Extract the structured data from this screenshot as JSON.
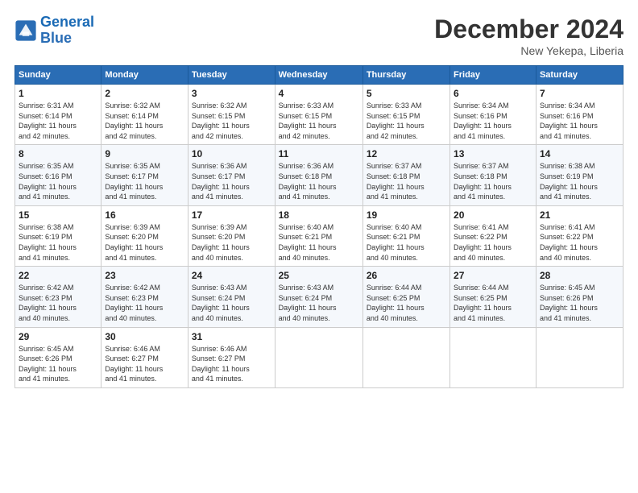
{
  "header": {
    "logo_line1": "General",
    "logo_line2": "Blue",
    "title": "December 2024",
    "subtitle": "New Yekepa, Liberia"
  },
  "days_of_week": [
    "Sunday",
    "Monday",
    "Tuesday",
    "Wednesday",
    "Thursday",
    "Friday",
    "Saturday"
  ],
  "weeks": [
    [
      {
        "day": "1",
        "info": "Sunrise: 6:31 AM\nSunset: 6:14 PM\nDaylight: 11 hours\nand 42 minutes."
      },
      {
        "day": "2",
        "info": "Sunrise: 6:32 AM\nSunset: 6:14 PM\nDaylight: 11 hours\nand 42 minutes."
      },
      {
        "day": "3",
        "info": "Sunrise: 6:32 AM\nSunset: 6:15 PM\nDaylight: 11 hours\nand 42 minutes."
      },
      {
        "day": "4",
        "info": "Sunrise: 6:33 AM\nSunset: 6:15 PM\nDaylight: 11 hours\nand 42 minutes."
      },
      {
        "day": "5",
        "info": "Sunrise: 6:33 AM\nSunset: 6:15 PM\nDaylight: 11 hours\nand 42 minutes."
      },
      {
        "day": "6",
        "info": "Sunrise: 6:34 AM\nSunset: 6:16 PM\nDaylight: 11 hours\nand 41 minutes."
      },
      {
        "day": "7",
        "info": "Sunrise: 6:34 AM\nSunset: 6:16 PM\nDaylight: 11 hours\nand 41 minutes."
      }
    ],
    [
      {
        "day": "8",
        "info": "Sunrise: 6:35 AM\nSunset: 6:16 PM\nDaylight: 11 hours\nand 41 minutes."
      },
      {
        "day": "9",
        "info": "Sunrise: 6:35 AM\nSunset: 6:17 PM\nDaylight: 11 hours\nand 41 minutes."
      },
      {
        "day": "10",
        "info": "Sunrise: 6:36 AM\nSunset: 6:17 PM\nDaylight: 11 hours\nand 41 minutes."
      },
      {
        "day": "11",
        "info": "Sunrise: 6:36 AM\nSunset: 6:18 PM\nDaylight: 11 hours\nand 41 minutes."
      },
      {
        "day": "12",
        "info": "Sunrise: 6:37 AM\nSunset: 6:18 PM\nDaylight: 11 hours\nand 41 minutes."
      },
      {
        "day": "13",
        "info": "Sunrise: 6:37 AM\nSunset: 6:18 PM\nDaylight: 11 hours\nand 41 minutes."
      },
      {
        "day": "14",
        "info": "Sunrise: 6:38 AM\nSunset: 6:19 PM\nDaylight: 11 hours\nand 41 minutes."
      }
    ],
    [
      {
        "day": "15",
        "info": "Sunrise: 6:38 AM\nSunset: 6:19 PM\nDaylight: 11 hours\nand 41 minutes."
      },
      {
        "day": "16",
        "info": "Sunrise: 6:39 AM\nSunset: 6:20 PM\nDaylight: 11 hours\nand 41 minutes."
      },
      {
        "day": "17",
        "info": "Sunrise: 6:39 AM\nSunset: 6:20 PM\nDaylight: 11 hours\nand 40 minutes."
      },
      {
        "day": "18",
        "info": "Sunrise: 6:40 AM\nSunset: 6:21 PM\nDaylight: 11 hours\nand 40 minutes."
      },
      {
        "day": "19",
        "info": "Sunrise: 6:40 AM\nSunset: 6:21 PM\nDaylight: 11 hours\nand 40 minutes."
      },
      {
        "day": "20",
        "info": "Sunrise: 6:41 AM\nSunset: 6:22 PM\nDaylight: 11 hours\nand 40 minutes."
      },
      {
        "day": "21",
        "info": "Sunrise: 6:41 AM\nSunset: 6:22 PM\nDaylight: 11 hours\nand 40 minutes."
      }
    ],
    [
      {
        "day": "22",
        "info": "Sunrise: 6:42 AM\nSunset: 6:23 PM\nDaylight: 11 hours\nand 40 minutes."
      },
      {
        "day": "23",
        "info": "Sunrise: 6:42 AM\nSunset: 6:23 PM\nDaylight: 11 hours\nand 40 minutes."
      },
      {
        "day": "24",
        "info": "Sunrise: 6:43 AM\nSunset: 6:24 PM\nDaylight: 11 hours\nand 40 minutes."
      },
      {
        "day": "25",
        "info": "Sunrise: 6:43 AM\nSunset: 6:24 PM\nDaylight: 11 hours\nand 40 minutes."
      },
      {
        "day": "26",
        "info": "Sunrise: 6:44 AM\nSunset: 6:25 PM\nDaylight: 11 hours\nand 40 minutes."
      },
      {
        "day": "27",
        "info": "Sunrise: 6:44 AM\nSunset: 6:25 PM\nDaylight: 11 hours\nand 41 minutes."
      },
      {
        "day": "28",
        "info": "Sunrise: 6:45 AM\nSunset: 6:26 PM\nDaylight: 11 hours\nand 41 minutes."
      }
    ],
    [
      {
        "day": "29",
        "info": "Sunrise: 6:45 AM\nSunset: 6:26 PM\nDaylight: 11 hours\nand 41 minutes."
      },
      {
        "day": "30",
        "info": "Sunrise: 6:46 AM\nSunset: 6:27 PM\nDaylight: 11 hours\nand 41 minutes."
      },
      {
        "day": "31",
        "info": "Sunrise: 6:46 AM\nSunset: 6:27 PM\nDaylight: 11 hours\nand 41 minutes."
      },
      null,
      null,
      null,
      null
    ]
  ]
}
